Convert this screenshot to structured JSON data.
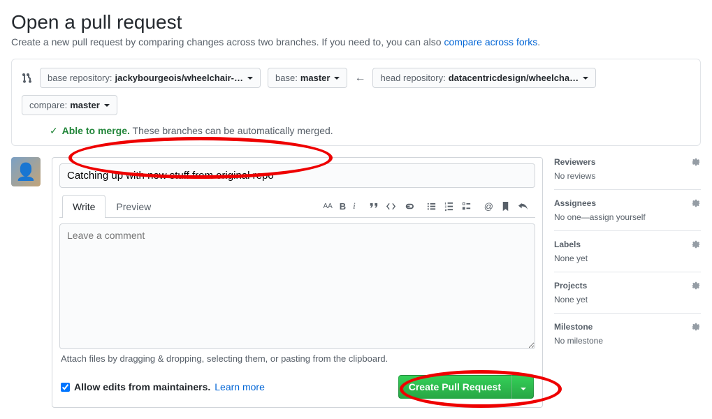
{
  "page": {
    "title": "Open a pull request",
    "subhead_prefix": "Create a new pull request by comparing changes across two branches. If you need to, you can also ",
    "subhead_link": "compare across forks",
    "subhead_suffix": "."
  },
  "compare": {
    "base_repo_label": "base repository: ",
    "base_repo_value": "jackybourgeois/wheelchair-…",
    "base_branch_label": "base: ",
    "base_branch_value": "master",
    "head_repo_label": "head repository: ",
    "head_repo_value": "datacentricdesign/wheelcha…",
    "compare_branch_label": "compare: ",
    "compare_branch_value": "master",
    "merge_ok_label": "Able to merge.",
    "merge_ok_detail": " These branches can be automatically merged."
  },
  "form": {
    "title_value": "Catching up with new stuff from original repo",
    "tab_write": "Write",
    "tab_preview": "Preview",
    "comment_placeholder": "Leave a comment",
    "attach_hint": "Attach files by dragging & dropping, selecting them, or pasting from the clipboard.",
    "allow_edits_label": "Allow edits from maintainers.",
    "learn_more": "Learn more",
    "submit_label": "Create Pull Request"
  },
  "sidebar": {
    "reviewers": {
      "title": "Reviewers",
      "body": "No reviews"
    },
    "assignees": {
      "title": "Assignees",
      "body": "No one—assign yourself"
    },
    "labels": {
      "title": "Labels",
      "body": "None yet"
    },
    "projects": {
      "title": "Projects",
      "body": "None yet"
    },
    "milestone": {
      "title": "Milestone",
      "body": "No milestone"
    }
  }
}
